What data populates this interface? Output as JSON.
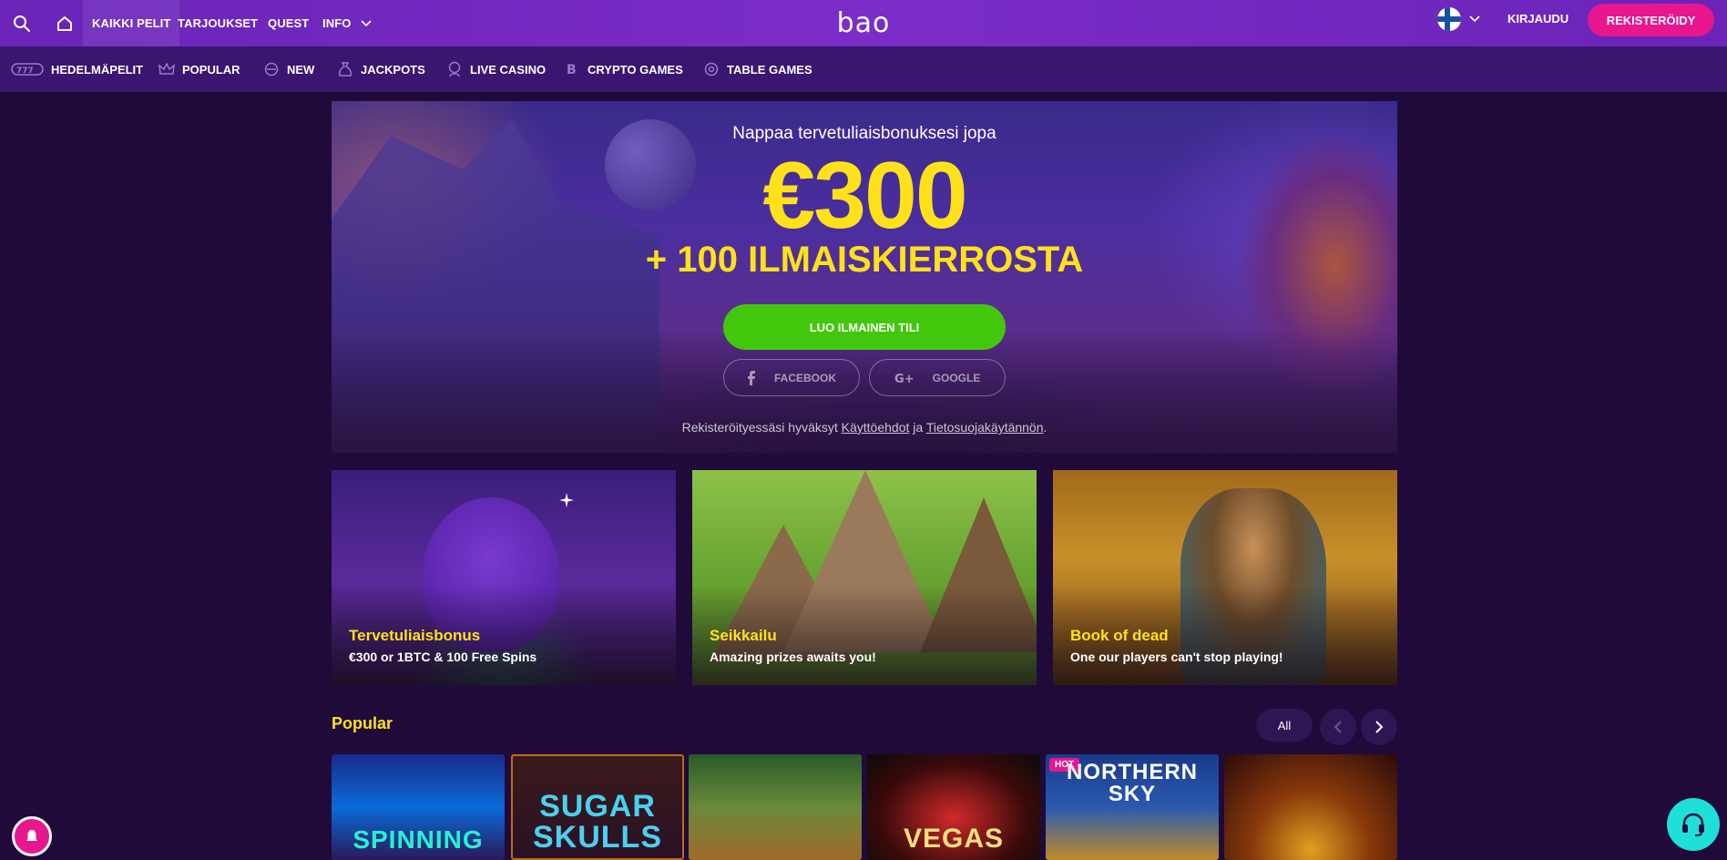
{
  "header": {
    "logo": "bao",
    "nav": [
      "KAIKKI PELIT",
      "TARJOUKSET",
      "QUEST",
      "INFO"
    ],
    "login": "KIRJAUDU",
    "register": "REKISTERÖIDY"
  },
  "categories": [
    "HEDELMÄPELIT",
    "POPULAR",
    "NEW",
    "JACKPOTS",
    "LIVE CASINO",
    "CRYPTO GAMES",
    "TABLE GAMES"
  ],
  "hero": {
    "subtitle": "Nappaa tervetuliaisbonuksesi jopa",
    "amount": "€300",
    "spins": "+ 100 ILMAISKIERROSTA",
    "cta": "LUO ILMAINEN TILI",
    "facebook": "FACEBOOK",
    "google": "GOOGLE",
    "terms_prefix": "Rekisteröityessäsi hyväksyt ",
    "terms_link1": "Käyttöehdot",
    "terms_mid": " ja ",
    "terms_link2": "Tietosuojakäytännön",
    "terms_suffix": "."
  },
  "promos": [
    {
      "title": "Tervetuliaisbonus",
      "subtitle": "€300 or 1BTC & 100 Free Spins"
    },
    {
      "title": "Seikkailu",
      "subtitle": "Amazing prizes awaits you!"
    },
    {
      "title": "Book of dead",
      "subtitle": "One our players can't stop playing!"
    }
  ],
  "popular": {
    "title": "Popular",
    "all": "All",
    "games": [
      {
        "label": "SPINNING",
        "hot": ""
      },
      {
        "label": "SUGAR SKULLS",
        "hot": ""
      },
      {
        "label": "",
        "hot": ""
      },
      {
        "label": "VEGAS",
        "hot": ""
      },
      {
        "label": "NORTHERN SKY",
        "hot": "HOT"
      },
      {
        "label": "",
        "hot": ""
      }
    ]
  },
  "colors": {
    "accent_yellow": "#ffe11a",
    "brand_pink": "#e8168f",
    "cta_green": "#43c70d",
    "topbar_purple": "#7b2dc8"
  }
}
